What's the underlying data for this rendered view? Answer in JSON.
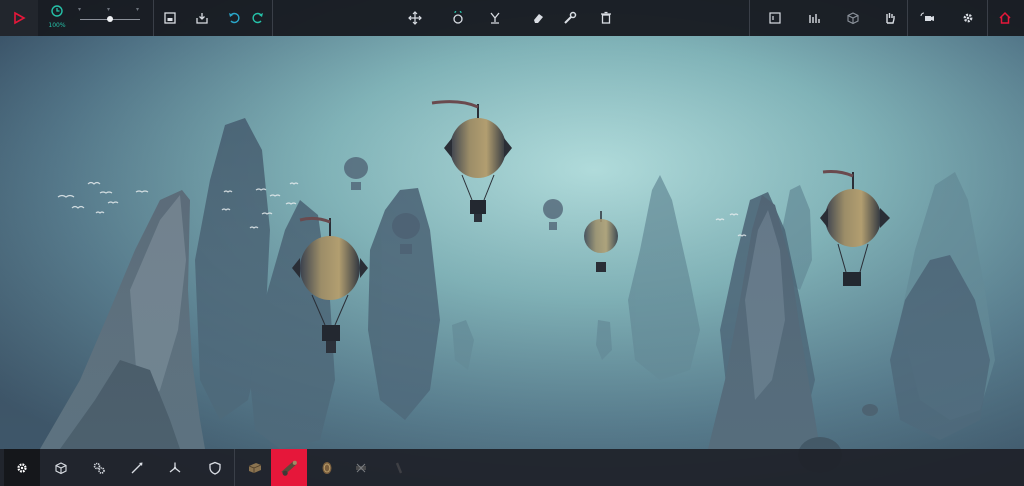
{
  "app": {
    "accent_color": "#e6173a",
    "teal_color": "#25c1a8"
  },
  "toolbar": {
    "play_icon": "play-icon",
    "time_scale": {
      "icon": "clock-icon",
      "label": "100%",
      "value_fraction": 0.5
    },
    "file_buttons": [
      "save-icon",
      "load-icon",
      "undo-icon",
      "redo-icon"
    ],
    "transform_tools": [
      "move-icon",
      "rotate-icon",
      "mirror-icon",
      "eraser-icon",
      "wrench-icon",
      "trash-icon"
    ],
    "view_buttons": [
      "blueprint-icon",
      "stats-icon",
      "cube-icon",
      "hand-icon",
      "camera-icon",
      "settings-icon",
      "home-icon"
    ]
  },
  "block_categories": [
    "gear-icon",
    "cube-icon",
    "gears-icon",
    "spear-icon",
    "propeller-icon",
    "shield-icon"
  ],
  "block_palette": {
    "items": [
      "crate-block",
      "cannon-block",
      "round-shield-block",
      "crossbow-block",
      "torch-block"
    ],
    "selected_index": 1
  }
}
